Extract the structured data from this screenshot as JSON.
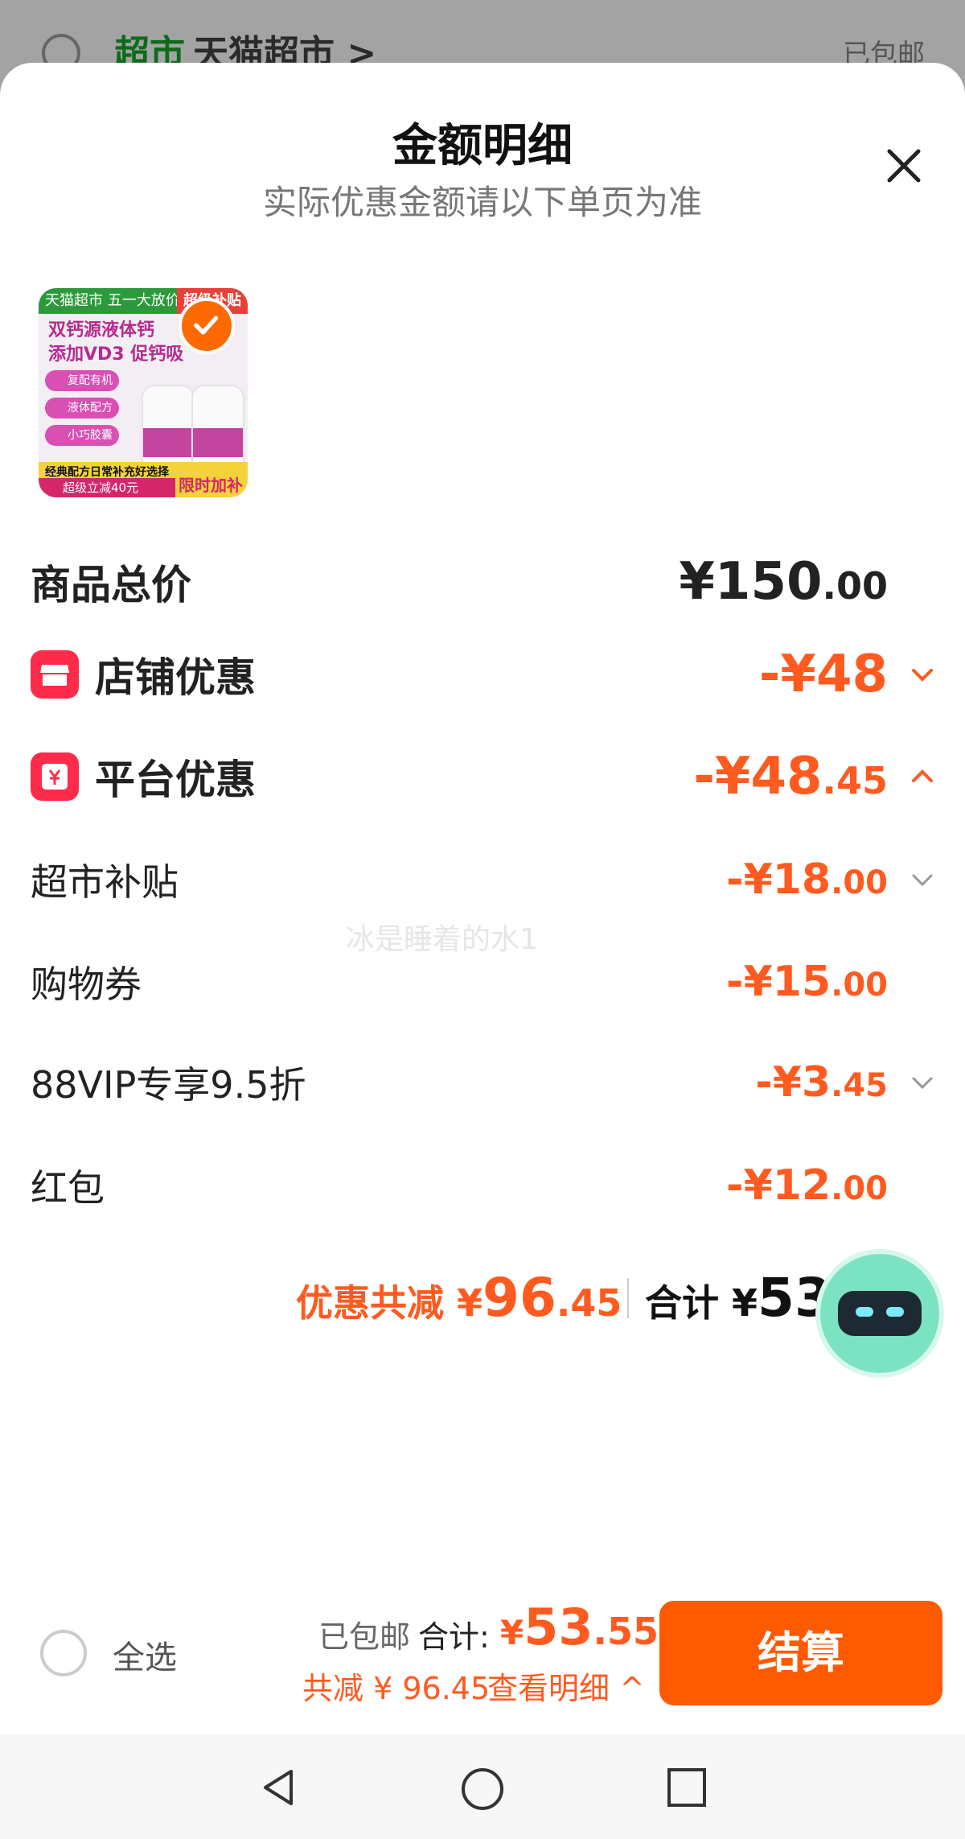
{
  "background": {
    "shop_tag": "超市",
    "shop_name": "天猫超市 >",
    "shipping": "已包邮"
  },
  "sheet": {
    "title": "金额明细",
    "subtitle": "实际优惠金额请以下单页为准",
    "close_icon": "close-icon"
  },
  "product": {
    "banner_left": "天猫超市 五一大放价",
    "banner_right": "超级补贴",
    "headline1": "双钙源液体钙",
    "headline2": "添加VD3 促钙吸",
    "chips": [
      "复配有机钙",
      "液体配方",
      "小巧胶囊"
    ],
    "promo_top": "经典配方日常补充好选择",
    "promo_bottom": "超级立减40元",
    "promo_right": "限时加补",
    "selected": true
  },
  "rows": {
    "total": {
      "label": "商品总价",
      "int": "¥150",
      "dec": ".00"
    },
    "shop": {
      "label": "店铺优惠",
      "int": "-¥48",
      "dec": ""
    },
    "platform": {
      "label": "平台优惠",
      "int": "-¥48",
      "dec": ".45"
    },
    "supermarket": {
      "label": "超市补贴",
      "int": "-¥18",
      "dec": ".00"
    },
    "coupon": {
      "label": "购物券",
      "int": "-¥15",
      "dec": ".00"
    },
    "vip": {
      "label": "88VIP专享9.5折",
      "int": "-¥3",
      "dec": ".45"
    },
    "redpacket": {
      "label": "红包",
      "int": "-¥12",
      "dec": ".00"
    }
  },
  "summary": {
    "discount_label": "优惠共减 ¥",
    "discount_int": "96",
    "discount_dec": ".45",
    "total_label": "合计 ¥",
    "total_int": "53"
  },
  "watermark": "冰是睡着的水1",
  "bottom": {
    "select_all": "全选",
    "shipping": "已包邮",
    "sum_label": "合计:",
    "sum_currency": "¥",
    "sum_int": "53",
    "sum_dec": ".55",
    "saved": "共减 ¥ 96.45",
    "detail": "查看明细 ^",
    "checkout": "结算"
  },
  "colors": {
    "accent": "#ff5a1f",
    "checkout": "#ff5a00",
    "badge": "#ff2b4a"
  }
}
